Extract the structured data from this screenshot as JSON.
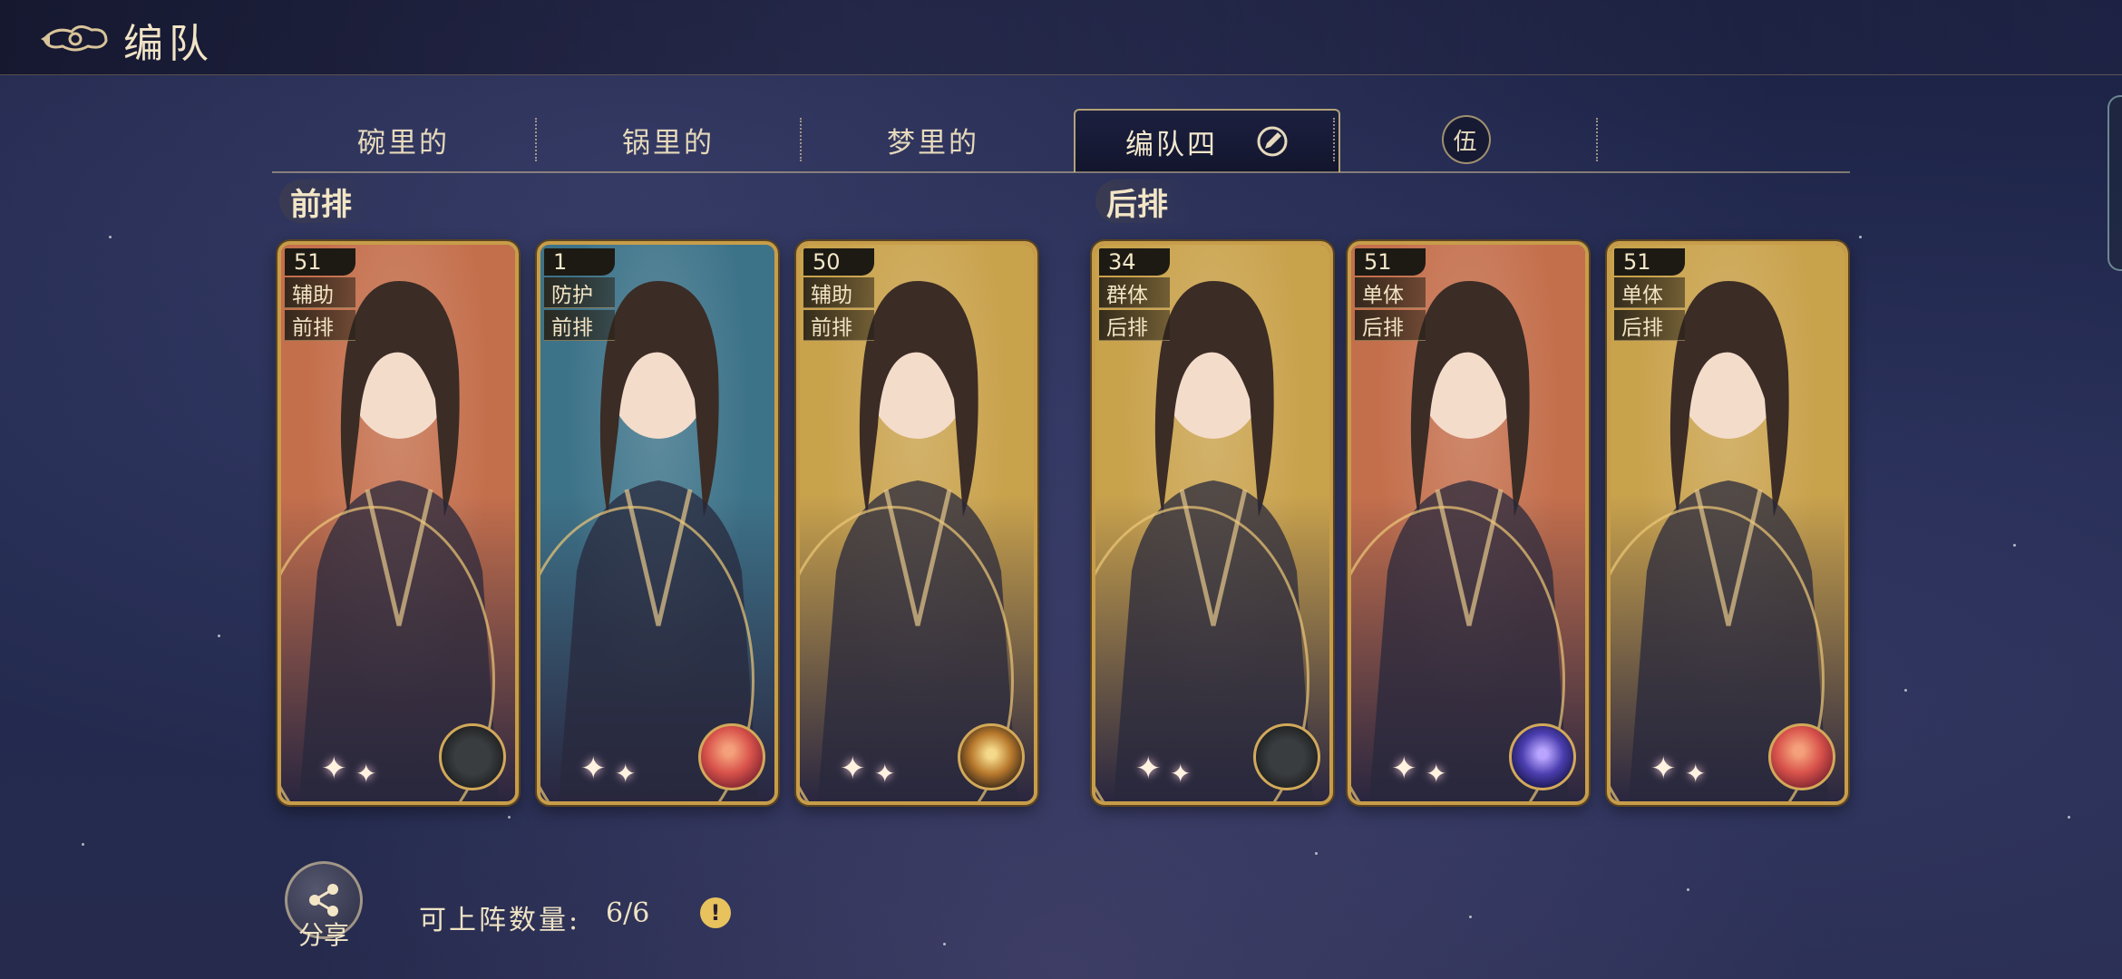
{
  "header": {
    "title": "编队",
    "back_icon": "cloud-back-icon"
  },
  "tabs": [
    {
      "label": "碗里的",
      "active": false
    },
    {
      "label": "锅里的",
      "active": false
    },
    {
      "label": "梦里的",
      "active": false
    },
    {
      "label": "编队四",
      "active": true,
      "edit_icon": "edit-pencil-icon"
    },
    {
      "label": "伍",
      "active": false,
      "is_badge": true
    }
  ],
  "rows": {
    "front": "前排",
    "back": "后排"
  },
  "cards": [
    {
      "level": "51",
      "role": "辅助",
      "position": "前排",
      "element": "dark-compass",
      "theme": "#c46f4c"
    },
    {
      "level": "1",
      "role": "防护",
      "position": "前排",
      "element": "red-planet",
      "theme": "#3d7389"
    },
    {
      "level": "50",
      "role": "辅助",
      "position": "前排",
      "element": "gold-moon",
      "theme": "#c9a24c"
    },
    {
      "level": "34",
      "role": "群体",
      "position": "后排",
      "element": "dark-compass",
      "theme": "#c9a24c"
    },
    {
      "level": "51",
      "role": "单体",
      "position": "后排",
      "element": "purple-planet",
      "theme": "#c46f4c"
    },
    {
      "level": "51",
      "role": "单体",
      "position": "后排",
      "element": "red-planet",
      "theme": "#c9a24c"
    }
  ],
  "footer": {
    "share_label": "分享",
    "count_label": "可上阵数量:",
    "count_value": "6/6",
    "hint_icon": "exclamation-icon"
  },
  "colors": {
    "gold": "#c89d4a",
    "text": "#f1e4c6",
    "bg": "#1f2548"
  }
}
